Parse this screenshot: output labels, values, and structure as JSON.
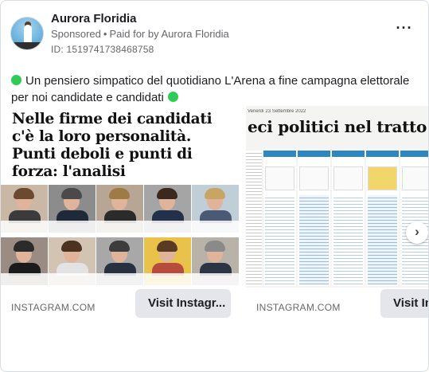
{
  "header": {
    "page_name": "Aurora Floridia",
    "sponsored_label": "Sponsored",
    "paid_for_prefix": "Paid for by",
    "paid_for_name": "Aurora Floridia",
    "ad_id": "ID: 1519741738468758",
    "more_icon": "ellipsis-icon"
  },
  "body_text": "Un pensiero simpatico del quotidiano L'Arena a fine campagna elettorale per noi candidate e candidati",
  "colors": {
    "accent_dot": "#2ecc54",
    "button_bg": "#e4e6eb",
    "secondary_text": "#65676b"
  },
  "carousel": {
    "cards": [
      {
        "headline": "Nelle firme dei candidati c'è la loro personalità. Punti deboli e punti di forza: l'analisi",
        "source": "INSTAGRAM.COM",
        "cta": "Visit Instagr..."
      },
      {
        "np_headline": "eci politici nel tratto di una",
        "np_date": "Venerdì 23 Settembre 2022",
        "source": "INSTAGRAM.COM",
        "cta": "Visit Ins"
      }
    ],
    "next_icon": "chevron-right-icon"
  }
}
